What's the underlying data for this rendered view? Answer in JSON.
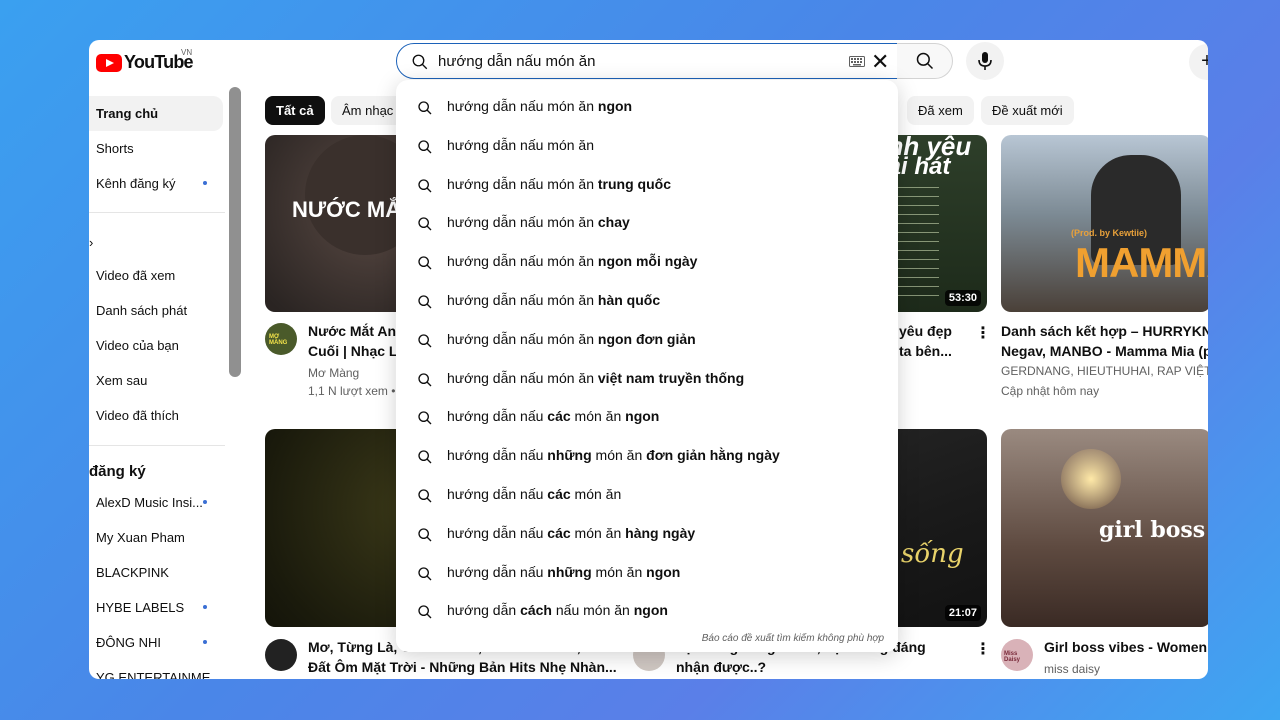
{
  "header": {
    "logo_text": "YouTube",
    "region": "VN",
    "search_value": "hướng dẫn nấu món ăn",
    "create_label": "+"
  },
  "sidebar": {
    "items": [
      {
        "label": "Trang chủ",
        "active": true
      },
      {
        "label": "Shorts"
      },
      {
        "label": "Kênh đăng ký",
        "dot": true
      }
    ],
    "you_items": [
      {
        "label": "Video đã xem"
      },
      {
        "label": "Danh sách phát"
      },
      {
        "label": "Video của bạn"
      },
      {
        "label": "Xem sau"
      },
      {
        "label": "Video đã thích"
      }
    ],
    "subscriptions_title": "đăng ký",
    "subscriptions": [
      {
        "label": "AlexD Music Insi...",
        "dot": true
      },
      {
        "label": "My Xuan Pham"
      },
      {
        "label": "BLACKPINK"
      },
      {
        "label": "HYBE LABELS",
        "dot": true
      },
      {
        "label": "ĐÔNG NHI",
        "dot": true
      },
      {
        "label": "YG ENTERTAINME..."
      }
    ]
  },
  "chips": [
    "Tất cả",
    "Âm nhạc",
    "Đã xem",
    "Đề xuất mới"
  ],
  "videos": [
    {
      "thumb_text": "NƯỚC MẮT A",
      "title1": "Nước Mắt Anh",
      "title2": "Cuối | Nhạc Lo",
      "channel": "Mơ Màng",
      "views": "1,1 N lượt xem •",
      "avatar_text": "MƠ MÀNG"
    },
    {
      "thumb_text1": "anh yêu",
      "thumb_text2": "hải hát",
      "duration": "53:30",
      "title1": "yêu đẹp",
      "title2": "ta bên..."
    },
    {
      "thumb_text": "MAMMA",
      "thumb_sub": "(Prod. by Kewtiie)",
      "title1": "Danh sách kết hợp – HURRYKNG",
      "title2": "Negav, MANBO - Mamma Mia (pr",
      "channel": "GERDNANG, HIEUTHUHAI, RAP VIỆT v",
      "views": "Cập nhật hôm nay"
    },
    {
      "title1": "Mơ, Từng Là, Có Em Chờ, Giấc Mơ Trưa, Trái",
      "title2": "Đất Ôm Mặt Trời - Những Bản Hits Nhẹ Nhàn..."
    },
    {
      "thumb_text": "sống",
      "duration": "21:07",
      "title1": "bạn đang sống có ổn, bạn xứng đáng",
      "title2": "nhận được..?"
    },
    {
      "thumb_text": "girl boss v",
      "title1": "Girl boss vibes - Women e",
      "channel": "miss daisy",
      "avatar_text": "Miss Daisy"
    }
  ],
  "suggestions": [
    {
      "prefix": "hướng dẫn nấu món ăn ",
      "bold": "ngon"
    },
    {
      "prefix": "hướng dẫn nấu món ăn",
      "bold": ""
    },
    {
      "prefix": "hướng dẫn nấu món ăn ",
      "bold": "trung quốc"
    },
    {
      "prefix": "hướng dẫn nấu món ăn ",
      "bold": "chay"
    },
    {
      "prefix": "hướng dẫn nấu món ăn ",
      "bold": "ngon mỗi ngày"
    },
    {
      "prefix": "hướng dẫn nấu món ăn ",
      "bold": "hàn quốc"
    },
    {
      "prefix": "hướng dẫn nấu món ăn ",
      "bold": "ngon đơn giản"
    },
    {
      "prefix": "hướng dẫn nấu món ăn ",
      "bold": "việt nam truyền thống"
    },
    {
      "prefix": "hướng dẫn nấu ",
      "bold": "các",
      "mid": " món ăn ",
      "bold2": "ngon"
    },
    {
      "prefix": "hướng dẫn nấu ",
      "bold": "những",
      "mid": " món ăn ",
      "bold2": "đơn giản hằng ngày"
    },
    {
      "prefix": "hướng dẫn nấu ",
      "bold": "các",
      "mid": " món ăn",
      "bold2": ""
    },
    {
      "prefix": "hướng dẫn nấu ",
      "bold": "các",
      "mid": " món ăn ",
      "bold2": "hàng ngày"
    },
    {
      "prefix": "hướng dẫn nấu ",
      "bold": "những",
      "mid": " món ăn ",
      "bold2": "ngon"
    },
    {
      "prefix": "hướng dẫn ",
      "bold": "cách",
      "mid": " nấu món ăn ",
      "bold2": "ngon"
    }
  ],
  "report_text": "Báo cáo đề xuất tìm kiếm không phù hợp",
  "colors": {
    "brand_red": "#ff0000",
    "focus_blue": "#1c62b9",
    "dot_blue": "#3b6fd4"
  }
}
